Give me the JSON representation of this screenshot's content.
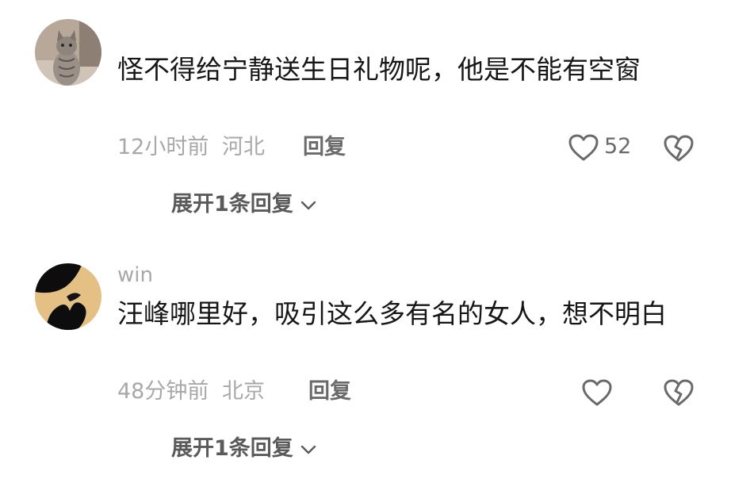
{
  "comments": [
    {
      "username": "",
      "avatar": "cat-photo",
      "text": "怪不得给宁静送生日礼物呢，他是不能有空窗",
      "time": "12小时前",
      "location": "河北",
      "reply_label": "回复",
      "like_count": "52",
      "expand_label": "展开1条回复"
    },
    {
      "username": "win",
      "avatar": "hands-silhouette",
      "text": "汪峰哪里好，吸引这么多有名的女人，想不明白",
      "time": "48分钟前",
      "location": "北京",
      "reply_label": "回复",
      "like_count": "",
      "expand_label": "展开1条回复"
    }
  ],
  "icons": {
    "like": "heart-outline-icon",
    "dislike": "broken-heart-icon",
    "expand": "chevron-down-icon"
  },
  "colors": {
    "text": "#161616",
    "meta": "#a8a8a8",
    "action": "#6a6a6a"
  }
}
